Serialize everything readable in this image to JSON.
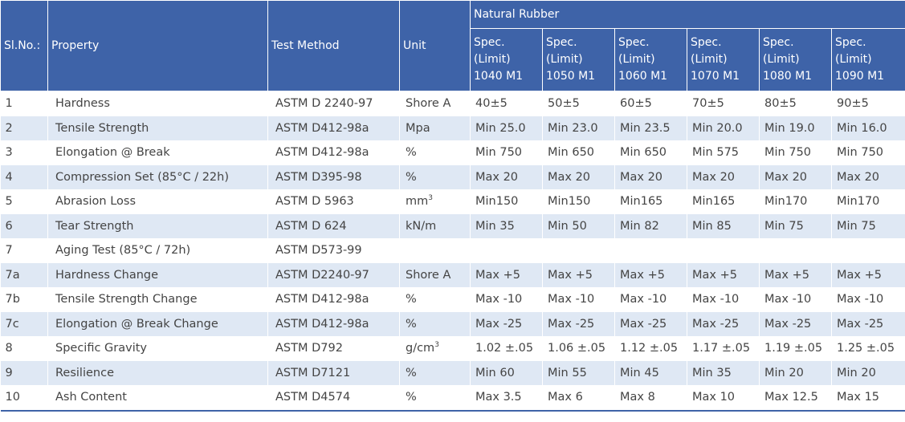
{
  "header": {
    "slno": "Sl.No.:",
    "property": "Property",
    "test_method": "Test Method",
    "unit": "Unit",
    "group": "Natural Rubber",
    "specs": [
      {
        "l1": "Spec.",
        "l2": "(Limit)",
        "l3": "1040 M1"
      },
      {
        "l1": "Spec.",
        "l2": "(Limit)",
        "l3": "1050 M1"
      },
      {
        "l1": "Spec.",
        "l2": "(Limit)",
        "l3": "1060 M1"
      },
      {
        "l1": "Spec.",
        "l2": "(Limit)",
        "l3": "1070 M1"
      },
      {
        "l1": "Spec.",
        "l2": "(Limit)",
        "l3": "1080 M1"
      },
      {
        "l1": "Spec.",
        "l2": "(Limit)",
        "l3": "1090 M1"
      }
    ]
  },
  "rows": [
    {
      "no": "1",
      "property": "Hardness",
      "method": "ASTM D 2240-97",
      "unit": "Shore A",
      "unit_sup": "",
      "vals": [
        "40±5",
        "50±5",
        "60±5",
        "70±5",
        "80±5",
        "90±5"
      ]
    },
    {
      "no": "2",
      "property": "Tensile Strength",
      "method": "ASTM D412-98a",
      "unit": "Mpa",
      "unit_sup": "",
      "vals": [
        "Min 25.0",
        "Min 23.0",
        "Min 23.5",
        "Min 20.0",
        "Min 19.0",
        "Min 16.0"
      ]
    },
    {
      "no": "3",
      "property": "Elongation @ Break",
      "method": "ASTM D412-98a",
      "unit": "%",
      "unit_sup": "",
      "vals": [
        "Min 750",
        "Min 650",
        "Min 650",
        "Min 575",
        "Min 750",
        "Min 750"
      ]
    },
    {
      "no": "4",
      "property": "Compression Set (85°C / 22h)",
      "method": "ASTM D395-98",
      "unit": "%",
      "unit_sup": "",
      "vals": [
        "Max 20",
        "Max 20",
        "Max 20",
        "Max 20",
        "Max 20",
        "Max 20"
      ]
    },
    {
      "no": "5",
      "property": "Abrasion Loss",
      "method": "ASTM D 5963",
      "unit": "mm",
      "unit_sup": "3",
      "vals": [
        "Min150",
        "Min150",
        "Min165",
        "Min165",
        "Min170",
        "Min170"
      ]
    },
    {
      "no": "6",
      "property": "Tear Strength",
      "method": "ASTM D 624",
      "unit": "kN/m",
      "unit_sup": "",
      "vals": [
        "Min 35",
        "Min 50",
        "Min 82",
        "Min 85",
        "Min 75",
        "Min 75"
      ]
    },
    {
      "no": "7",
      "property": "Aging Test (85°C / 72h)",
      "method": "ASTM D573-99",
      "unit": "",
      "unit_sup": "",
      "vals": [
        "",
        "",
        "",
        "",
        "",
        ""
      ]
    },
    {
      "no": "7a",
      "property": "Hardness Change",
      "method": "ASTM D2240-97",
      "unit": "Shore A",
      "unit_sup": "",
      "vals": [
        "Max +5",
        "Max +5",
        "Max +5",
        "Max +5",
        "Max +5",
        "Max +5"
      ]
    },
    {
      "no": "7b",
      "property": "Tensile Strength Change",
      "method": "ASTM D412-98a",
      "unit": "%",
      "unit_sup": "",
      "vals": [
        "Max -10",
        "Max -10",
        "Max -10",
        "Max -10",
        "Max -10",
        "Max -10"
      ]
    },
    {
      "no": "7c",
      "property": "Elongation @ Break Change",
      "method": "ASTM D412-98a",
      "unit": "%",
      "unit_sup": "",
      "vals": [
        "Max -25",
        "Max -25",
        "Max -25",
        "Max -25",
        "Max -25",
        "Max -25"
      ]
    },
    {
      "no": "8",
      "property": "Specific Gravity",
      "method": "ASTM D792",
      "unit": "g/cm",
      "unit_sup": "3",
      "vals": [
        "1.02 ±.05",
        "1.06 ±.05",
        "1.12 ±.05",
        "1.17 ±.05",
        "1.19 ±.05",
        "1.25 ±.05"
      ]
    },
    {
      "no": "9",
      "property": "Resilience",
      "method": "ASTM D7121",
      "unit": "%",
      "unit_sup": "",
      "vals": [
        "Min 60",
        "Min 55",
        "Min 45",
        "Min 35",
        "Min 20",
        "Min 20"
      ]
    },
    {
      "no": "10",
      "property": "Ash Content",
      "method": "ASTM D4574",
      "unit": "%",
      "unit_sup": "",
      "vals": [
        "Max 3.5",
        "Max 6",
        "Max 8",
        "Max 10",
        "Max 12.5",
        "Max 15"
      ]
    }
  ]
}
